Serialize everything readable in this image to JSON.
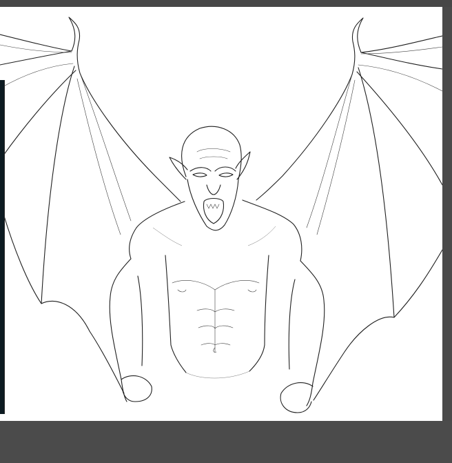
{
  "app": {
    "view": "drawing-canvas"
  },
  "document": {
    "subject": "line-art-artwork",
    "background_color": "#ffffff",
    "workspace_color": "#4a4a4a",
    "side_panel_color": "#0d1b22"
  }
}
